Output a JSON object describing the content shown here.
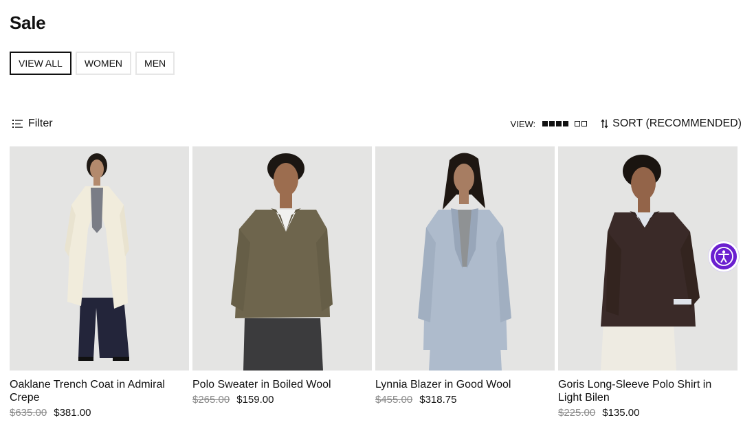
{
  "page": {
    "title": "Sale"
  },
  "tabs": [
    {
      "label": "VIEW ALL",
      "active": true
    },
    {
      "label": "WOMEN",
      "active": false
    },
    {
      "label": "MEN",
      "active": false
    }
  ],
  "toolbar": {
    "filter_label": "Filter",
    "view_label": "VIEW:",
    "sort_label": "SORT (RECOMMENDED)"
  },
  "products": [
    {
      "name": "Oaklane Trench Coat in Admiral Crepe",
      "original_price": "$635.00",
      "sale_price": "$381.00",
      "image": "model-trench-coat",
      "colors": {
        "garment": "#f1ecdc",
        "trousers": "#23253a"
      }
    },
    {
      "name": "Polo Sweater in Boiled Wool",
      "original_price": "$265.00",
      "sale_price": "$159.00",
      "image": "model-polo-sweater",
      "colors": {
        "garment": "#6e654d",
        "trousers": "#3b3b3d"
      }
    },
    {
      "name": "Lynnia Blazer in Good Wool",
      "original_price": "$455.00",
      "sale_price": "$318.75",
      "image": "model-blazer",
      "colors": {
        "garment": "#aebbcc",
        "trousers": "#aebbcc"
      }
    },
    {
      "name": "Goris Long-Sleeve Polo Shirt in Light Bilen",
      "original_price": "$225.00",
      "sale_price": "$135.00",
      "image": "model-polo-shirt",
      "colors": {
        "garment": "#3a2a28",
        "trousers": "#eeebe2"
      }
    }
  ],
  "accessibility": {
    "icon": "accessibility-icon",
    "color": "#6a1fd0"
  }
}
